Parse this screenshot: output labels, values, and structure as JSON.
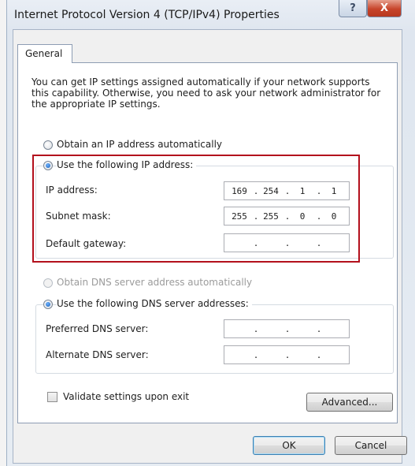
{
  "window": {
    "title": "Internet Protocol Version 4 (TCP/IPv4) Properties",
    "help_label": "?",
    "close_label": "X"
  },
  "tabs": [
    {
      "label": "General",
      "selected": true
    }
  ],
  "intro_text": "You can get IP settings assigned automatically if your network supports this capability. Otherwise, you need to ask your network administrator for the appropriate IP settings.",
  "ip_section": {
    "auto_label": "Obtain an IP address automatically",
    "manual_label": "Use the following IP address:",
    "selected": "manual",
    "fields": [
      {
        "label": "IP address:",
        "octets": [
          "169",
          "254",
          "1",
          "1"
        ]
      },
      {
        "label": "Subnet mask:",
        "octets": [
          "255",
          "255",
          "0",
          "0"
        ]
      },
      {
        "label": "Default gateway:",
        "octets": [
          "",
          "",
          "",
          ""
        ]
      }
    ]
  },
  "dns_section": {
    "auto_label": "Obtain DNS server address automatically",
    "auto_enabled": false,
    "manual_label": "Use the following DNS server addresses:",
    "selected": "manual",
    "fields": [
      {
        "label": "Preferred DNS server:",
        "octets": [
          "",
          "",
          "",
          ""
        ]
      },
      {
        "label": "Alternate DNS server:",
        "octets": [
          "",
          "",
          "",
          ""
        ]
      }
    ]
  },
  "validate_label": "Validate settings upon exit",
  "validate_checked": false,
  "buttons": {
    "advanced": "Advanced...",
    "ok": "OK",
    "cancel": "Cancel"
  },
  "colors": {
    "highlight_border": "#b3101c",
    "close_button": "#c7442a"
  }
}
